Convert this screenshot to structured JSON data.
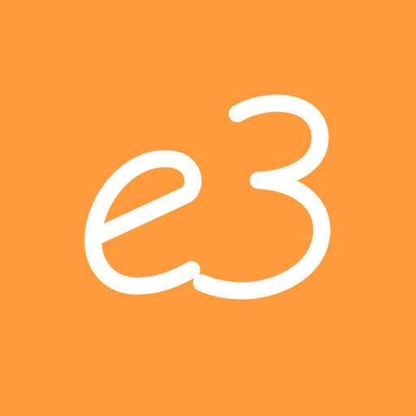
{
  "app_icon": {
    "logo_text": "e3",
    "background_color": "#FF9B3D",
    "foreground_color": "#FFFFFF"
  }
}
